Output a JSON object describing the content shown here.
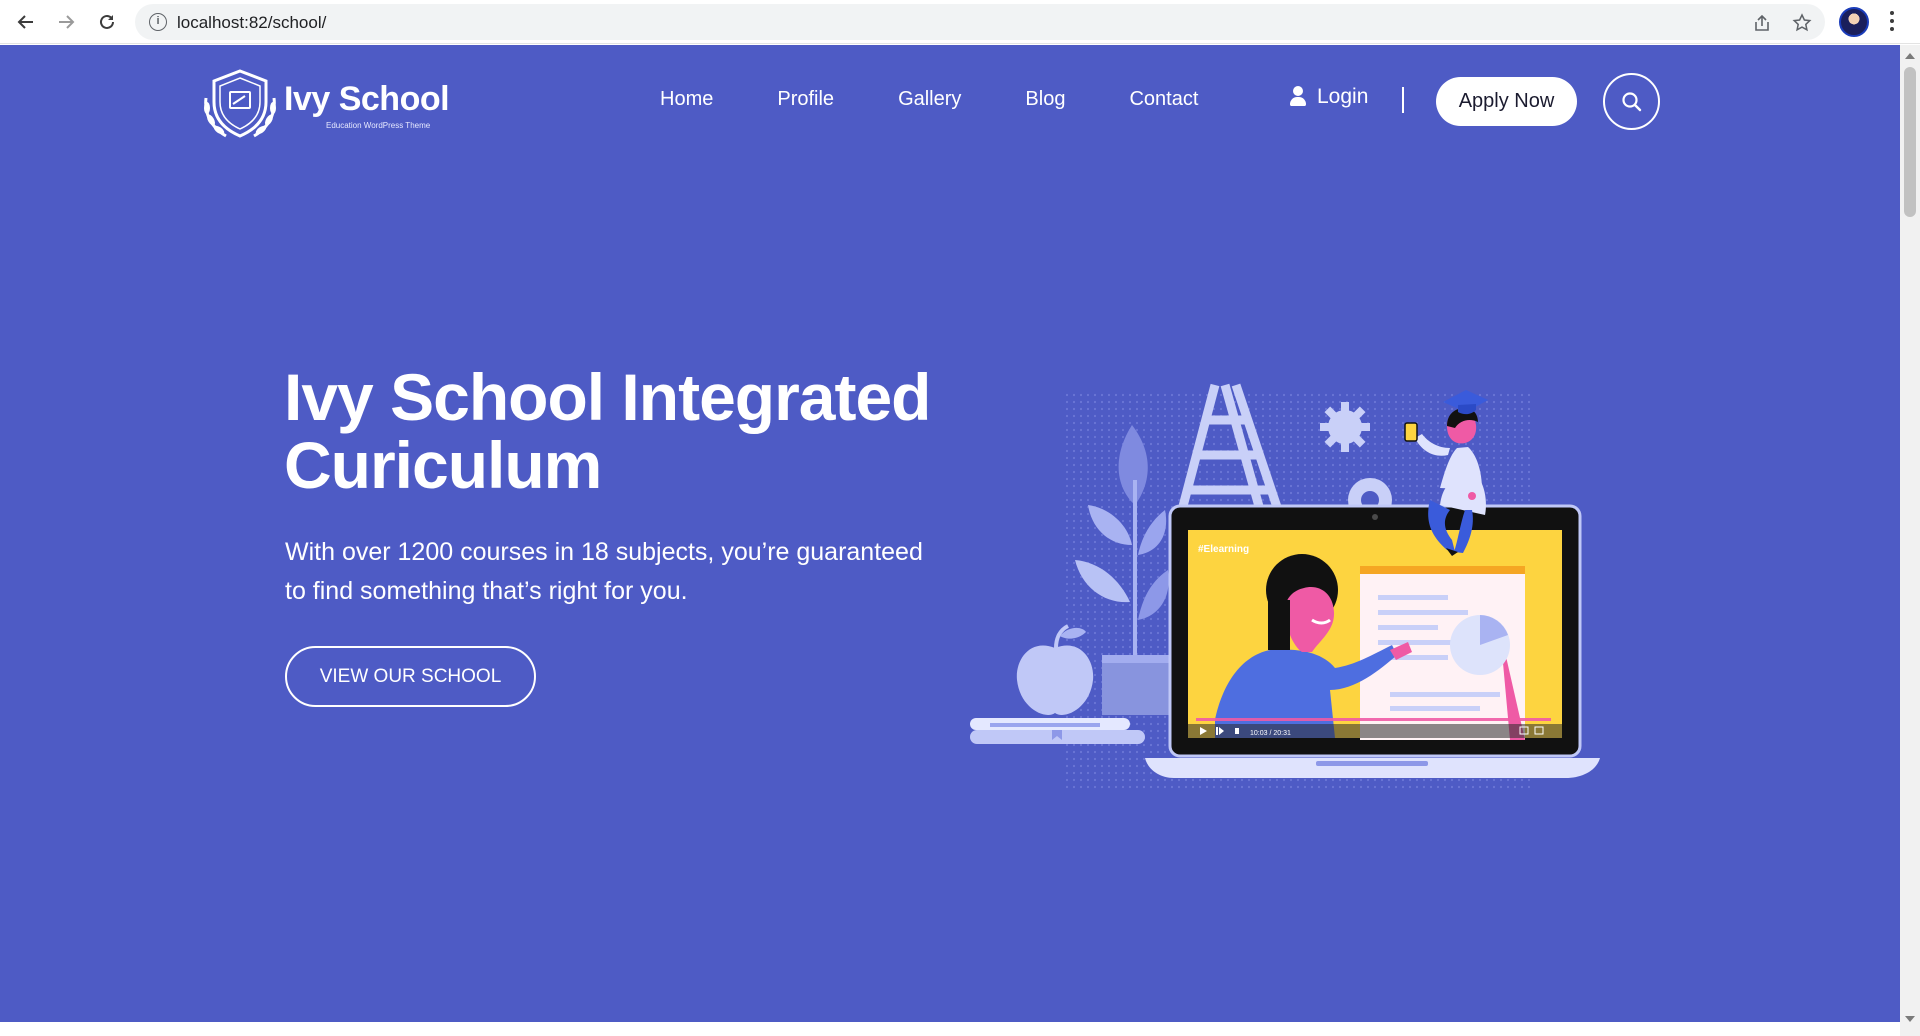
{
  "browser": {
    "url": "localhost:82/school/"
  },
  "header": {
    "logo_name": "Ivy School",
    "logo_tagline": "Education WordPress Theme",
    "menu": [
      {
        "label": "Home"
      },
      {
        "label": "Profile"
      },
      {
        "label": "Gallery"
      },
      {
        "label": "Blog"
      },
      {
        "label": "Contact"
      }
    ],
    "login_label": "Login",
    "apply_label": "Apply Now"
  },
  "hero": {
    "title": "Ivy School Integrated Curiculum",
    "subtitle": "With over 1200 courses in 18 subjects, you’re guaranteed to find something that’s right for you.",
    "cta_label": "VIEW OUR SCHOOL",
    "video_tag": "#Elearning",
    "video_time": "10:03 / 20:31"
  },
  "colors": {
    "hero_bg": "#4e5bc5",
    "accent_yellow": "#fdd440",
    "accent_pink": "#ef5aa5",
    "light_lavender": "#b8c2f5"
  }
}
